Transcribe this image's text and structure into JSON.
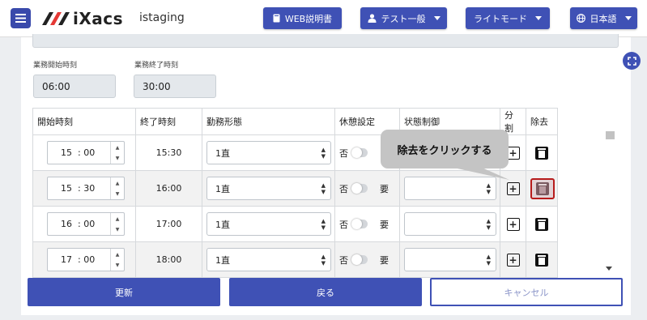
{
  "header": {
    "brand": "iXacs",
    "environment": "istaging",
    "manual_label": "WEB説明書",
    "user_label": "テスト一般",
    "mode_label": "ライトモード",
    "language_label": "日本語",
    "accent_color": "#3f51b5"
  },
  "work_hours": {
    "start_label": "業務開始時刻",
    "start_value": "06:00",
    "end_label": "業務終了時刻",
    "end_value": "30:00"
  },
  "table": {
    "columns": [
      "開始時刻",
      "終了時刻",
      "勤務形態",
      "休憩設定",
      "状態制御",
      "分割",
      "除去"
    ],
    "rows": [
      {
        "start_h": "15",
        "start_m": "00",
        "end": "15:30",
        "shift": "1直",
        "break_off": "否",
        "break_on": "",
        "highlighted": false
      },
      {
        "start_h": "15",
        "start_m": "30",
        "end": "16:00",
        "shift": "1直",
        "break_off": "否",
        "break_on": "要",
        "highlighted": true
      },
      {
        "start_h": "16",
        "start_m": "00",
        "end": "17:00",
        "shift": "1直",
        "break_off": "否",
        "break_on": "要",
        "highlighted": false
      },
      {
        "start_h": "17",
        "start_m": "00",
        "end": "18:00",
        "shift": "1直",
        "break_off": "否",
        "break_on": "要",
        "highlighted": false
      }
    ]
  },
  "footer": {
    "update_label": "更新",
    "back_label": "戻る",
    "cancel_label": "キャンセル"
  },
  "tooltip": {
    "text": "除去をクリックする"
  }
}
